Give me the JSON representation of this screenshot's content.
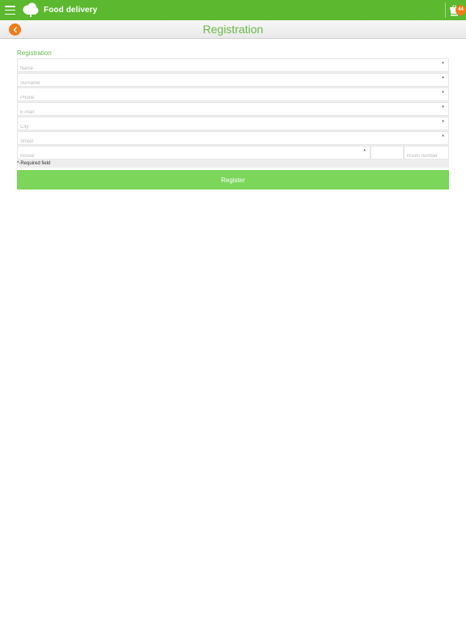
{
  "app": {
    "title": "Food delivery",
    "cart_count": "44",
    "accent": "#5cb82f",
    "badge_color": "#f07c18"
  },
  "page": {
    "title": "Registration"
  },
  "form": {
    "section_label": "Registration",
    "fields": {
      "name": {
        "placeholder": "Name",
        "required_mark": "*"
      },
      "surname": {
        "placeholder": "Surname",
        "required_mark": "*"
      },
      "phone": {
        "placeholder": "Phone",
        "required_mark": "*"
      },
      "email": {
        "placeholder": "E-mail",
        "required_mark": "*"
      },
      "city": {
        "placeholder": "City",
        "required_mark": "*"
      },
      "street": {
        "placeholder": "Street",
        "required_mark": "*"
      },
      "house": {
        "placeholder": "House",
        "required_mark": "*"
      },
      "room_number": {
        "placeholder": "Room number"
      }
    },
    "required_note": "*-Required field",
    "submit_label": "Register",
    "submit_color": "#7bd65a"
  }
}
